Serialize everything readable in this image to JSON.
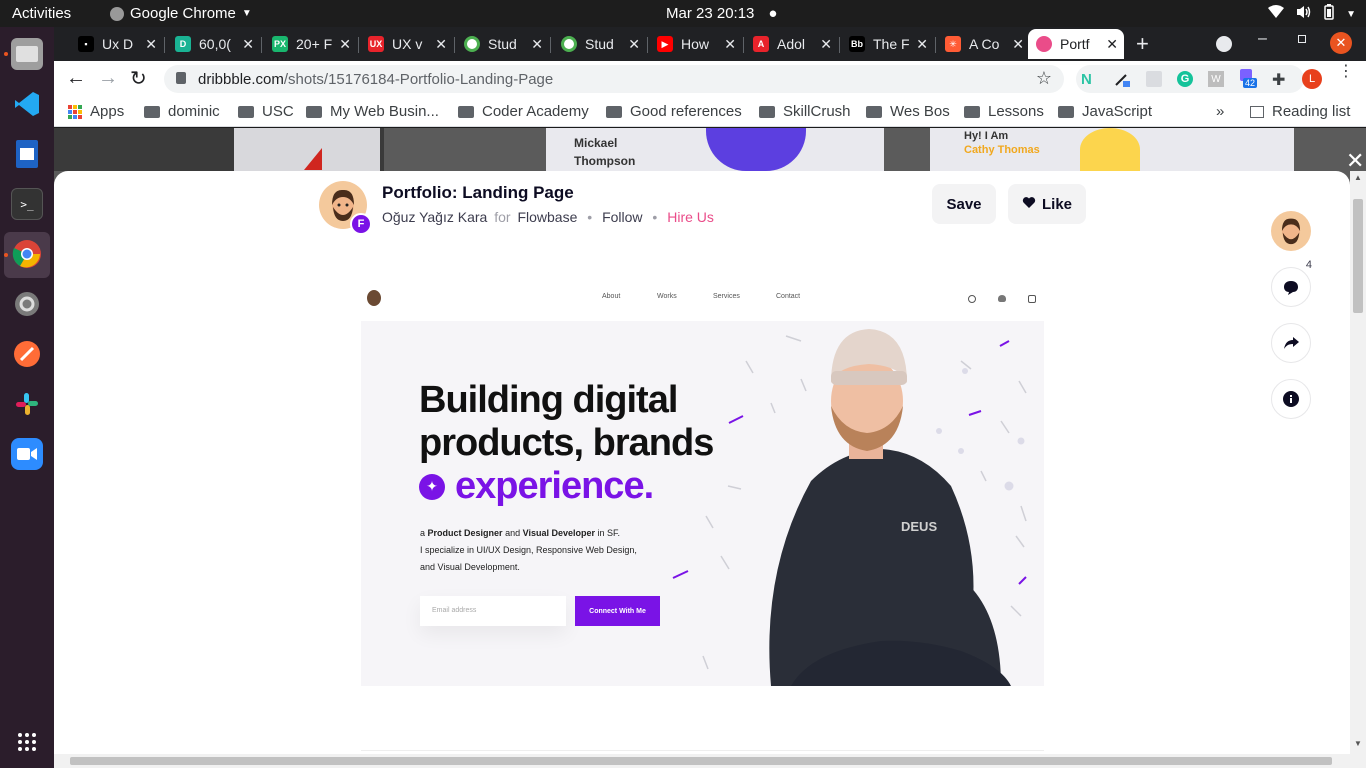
{
  "topbar": {
    "activities": "Activities",
    "app_name": "Google Chrome",
    "clock": "Mar 23  20:13"
  },
  "tabs": [
    "Ux D",
    "60,0(",
    "20+ F",
    "UX v",
    "Stud",
    "Stud",
    "How",
    "Adol",
    "The F",
    "A Co",
    "Portf"
  ],
  "tab_colors": [
    "#000000",
    "#1ab394",
    "#19b66e",
    "#e8232b",
    "#ffffff",
    "#ffffff",
    "#ff0000",
    "#e8232b",
    "#000000",
    "#ff5c35",
    "#ea4c89"
  ],
  "tab_icon_text": [
    "▪",
    "D",
    "PX",
    "UX",
    "",
    "",
    "▶",
    "A",
    "Bb",
    "✳",
    ""
  ],
  "address": {
    "domain": "dribbble.com",
    "path": "/shots/15176184-Portfolio-Landing-Page"
  },
  "extensions": {
    "badge": "42",
    "profile_initial": "L"
  },
  "bookmarks": {
    "apps": "Apps",
    "folders": [
      "dominic",
      "USC",
      "My Web Busin...",
      "Coder Academy",
      "Good references",
      "SkillCrush",
      "Wes Bos",
      "Lessons",
      "JavaScript"
    ],
    "more": "»",
    "reading_list": "Reading list"
  },
  "background_page": {
    "name": "Mickael Thompson",
    "greeting": "Hy! I Am",
    "name2": "Cathy Thomas"
  },
  "shot": {
    "title": "Portfolio: Landing Page",
    "author": "Oğuz Yağız Kara",
    "for": "for",
    "team": "Flowbase",
    "follow": "Follow",
    "hire": "Hire Us",
    "save": "Save",
    "like": "Like",
    "comment_count": "4"
  },
  "design": {
    "nav": [
      "About",
      "Works",
      "Services",
      "Contact"
    ],
    "headline1": "Building digital",
    "headline2": "products, brands",
    "headline3": "experience",
    "sub_a": "a",
    "sub_b": "Product Designer",
    "sub_c": "and",
    "sub_d": "Visual Developer",
    "sub_e": "in SF.",
    "sub2": "I specialize in UI/UX Design, Responsive Web Design,",
    "sub3": "and Visual Development.",
    "email_placeholder": "Email address",
    "cta": "Connect With Me",
    "shirt": "DEUS"
  },
  "colors": {
    "accent_purple": "#7a13e6",
    "dribbble_pink": "#ea4c89",
    "chrome_dark": "#202124"
  }
}
